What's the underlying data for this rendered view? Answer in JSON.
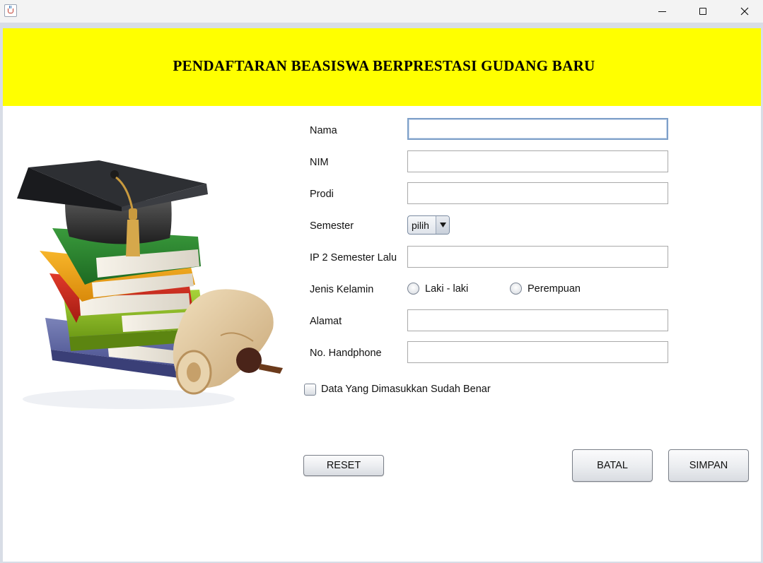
{
  "window": {
    "app_icon": "java-cup-icon",
    "controls": {
      "minimize": "minimize-icon",
      "maximize": "maximize-icon",
      "close": "close-icon"
    }
  },
  "header": {
    "title": "PENDAFTARAN BEASISWA BERPRESTASI GUDANG BARU",
    "background": "#ffff00"
  },
  "illustration": "graduation-books-icon",
  "form": {
    "nama": {
      "label": "Nama",
      "value": ""
    },
    "nim": {
      "label": "NIM",
      "value": ""
    },
    "prodi": {
      "label": "Prodi",
      "value": ""
    },
    "semester": {
      "label": "Semester",
      "selected": "pilih"
    },
    "ip": {
      "label": "IP 2 Semester Lalu",
      "value": ""
    },
    "jenis_kelamin": {
      "label": "Jenis Kelamin",
      "options": [
        {
          "label": "Laki - laki",
          "selected": false
        },
        {
          "label": "Perempuan",
          "selected": false
        }
      ]
    },
    "alamat": {
      "label": "Alamat",
      "value": ""
    },
    "hp": {
      "label": "No. Handphone",
      "value": ""
    },
    "confirm": {
      "label": "Data Yang Dimasukkan Sudah Benar",
      "checked": false
    }
  },
  "buttons": {
    "reset": "RESET",
    "batal": "BATAL",
    "simpan": "SIMPAN"
  }
}
